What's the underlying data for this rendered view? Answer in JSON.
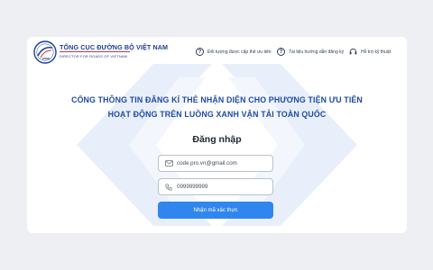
{
  "brand": {
    "name": "TỔNG CỤC ĐƯỜNG BỘ VIỆT NAM",
    "subtitle": "DIRECTOR FOR ROADS OF VIETNAM",
    "logo_icon": "road-logo-icon"
  },
  "nav": [
    {
      "label": "Đối tượng được cấp thẻ ưu tiên",
      "icon": "question-icon"
    },
    {
      "label": "Tài liệu hướng dẫn đăng ký",
      "icon": "question-icon"
    },
    {
      "label": "Hỗ trợ kỹ thuật",
      "icon": "headset-icon"
    }
  ],
  "portal": {
    "title_line1": "CỔNG THÔNG TIN ĐĂNG KÍ THẺ NHẬN DIỆN CHO PHƯƠNG TIỆN ƯU TIÊN",
    "title_line2": "HOẠT ĐỘNG TRÊN LUỒNG XANH VẬN TẢI TOÀN QUỐC"
  },
  "login": {
    "heading": "Đăng nhập",
    "email_value": "code.pro.vn@gmail.com",
    "phone_value": "0999999999",
    "submit_label": "Nhận mã xác thực"
  },
  "colors": {
    "accent": "#2f86ee",
    "title": "#1e4aa6",
    "background": "#edeff3"
  }
}
